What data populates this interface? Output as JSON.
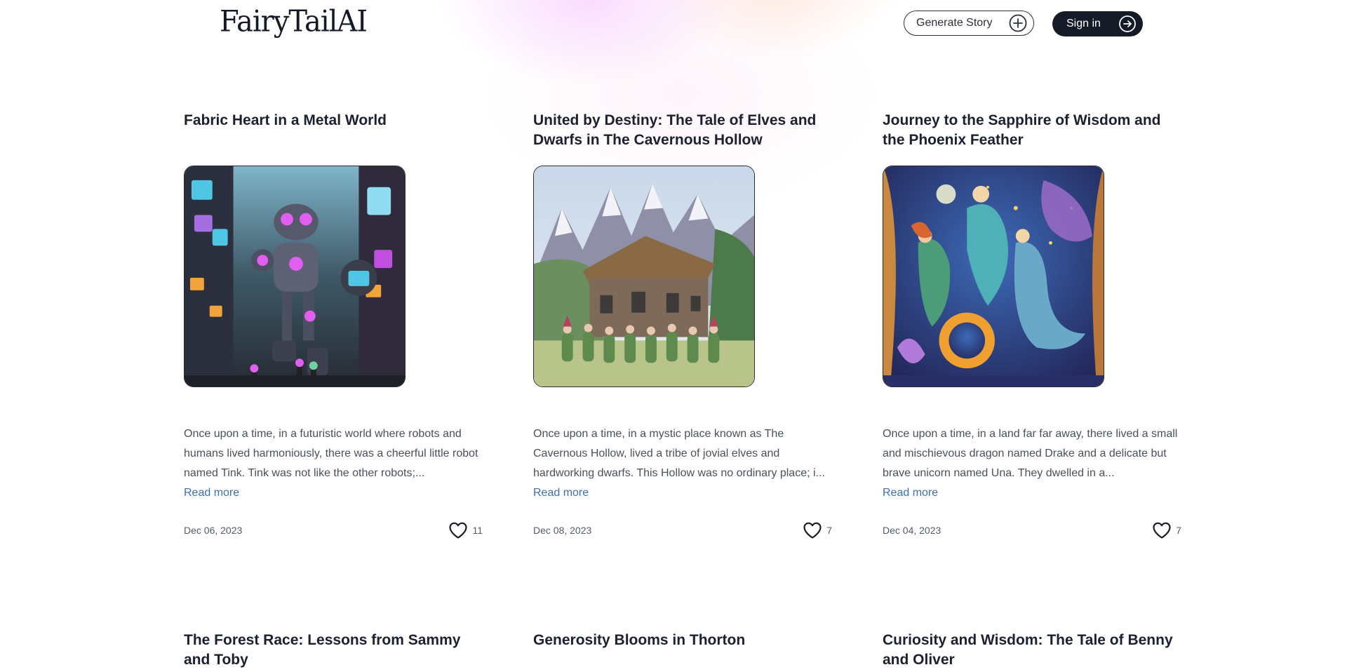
{
  "header": {
    "logo": "FairyTailAI",
    "generate_label": "Generate Story",
    "signin_label": "Sign in"
  },
  "stories": [
    {
      "title": "Fabric Heart in a Metal World",
      "excerpt": "Once upon a time, in a futuristic world where robots and humans lived harmoniously, there was a cheerful little robot named Tink. Tink was not like the other robots;...",
      "read_more": "Read more",
      "date": "Dec 06, 2023",
      "likes": "11"
    },
    {
      "title": "United by Destiny: The Tale of Elves and Dwarfs in The Cavernous Hollow",
      "excerpt": "Once upon a time, in a mystic place known as The Cavernous Hollow, lived a tribe of jovial elves and hardworking dwarfs. This Hollow was no ordinary place; i...",
      "read_more": "Read more",
      "date": "Dec 08, 2023",
      "likes": "7"
    },
    {
      "title": "Journey to the Sapphire of Wisdom and the Phoenix Feather",
      "excerpt": "Once upon a time, in a land far far away, there lived a small and mischievous dragon named Drake and a delicate but brave unicorn named Una. They dwelled in a...",
      "read_more": "Read more",
      "date": "Dec 04, 2023",
      "likes": "7"
    },
    {
      "title": "The Forest Race: Lessons from Sammy and Toby"
    },
    {
      "title": "Generosity Blooms in Thorton"
    },
    {
      "title": "Curiosity and Wisdom: The Tale of Benny and Oliver"
    }
  ],
  "icons": {
    "generate": "plus-circle-icon",
    "signin": "arrow-right-circle-icon",
    "like": "heart-icon"
  },
  "colors": {
    "dark": "#141a26",
    "link": "#3d6fb0"
  }
}
